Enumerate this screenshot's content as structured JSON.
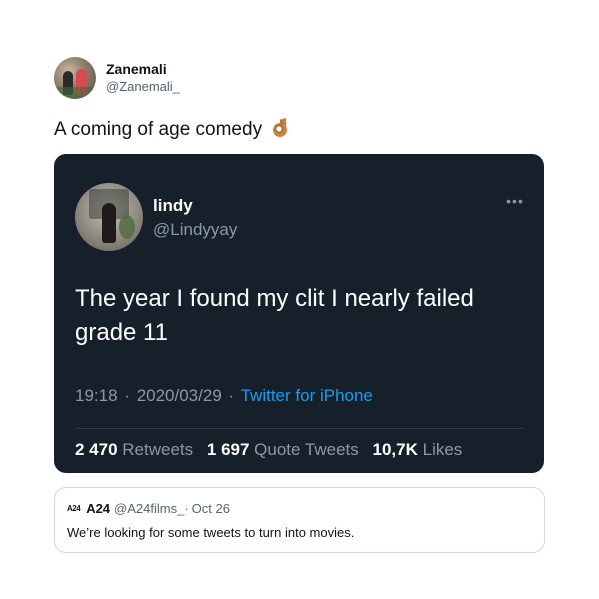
{
  "outer_tweet": {
    "name": "Zanemali",
    "handle": "@Zanemali_",
    "text": "A coming of age comedy",
    "emoji": "ok-hand-emoji"
  },
  "quoted_tweet": {
    "name": "lindy",
    "handle": "@Lindyyay",
    "more_label": "•••",
    "text": "The year I found my clit I nearly failed grade 11",
    "time": "19:18",
    "date": "2020/03/29",
    "separator": "·",
    "source": "Twitter for iPhone",
    "stats": [
      {
        "value": "2 470",
        "label": "Retweets"
      },
      {
        "value": "1 697",
        "label": "Quote Tweets"
      },
      {
        "value": "10,7K",
        "label": "Likes"
      }
    ]
  },
  "reply_card": {
    "logo": "A24",
    "name": "A24",
    "handle": "@A24films_",
    "separator": "·",
    "date": "Oct 26",
    "text": "We’re looking for some tweets to turn into movies."
  },
  "colors": {
    "dark_card": "#15202b",
    "link": "#1d9bf0",
    "muted_dark": "#8b98a5",
    "muted_light": "#536471"
  }
}
